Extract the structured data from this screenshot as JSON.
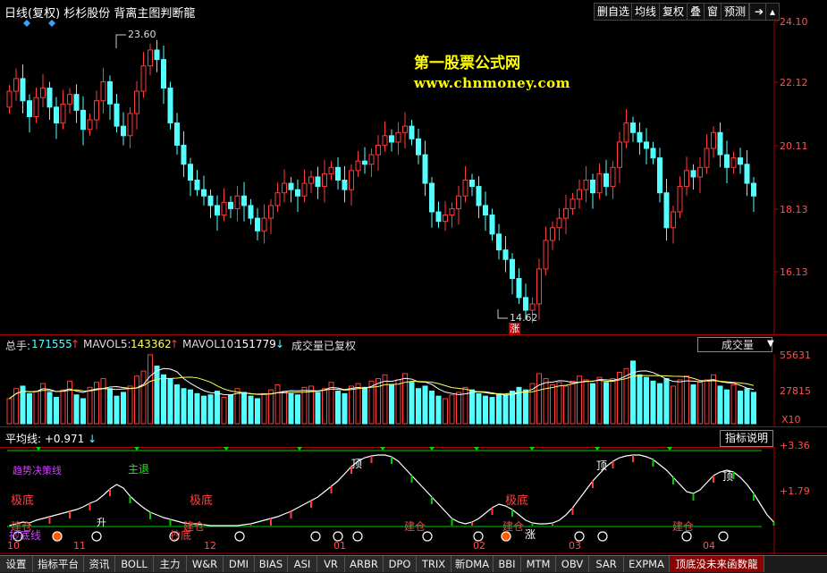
{
  "header": {
    "title": "日线(复权)  杉杉股份  背离主图判断龍",
    "buttons": [
      "删自选",
      "均线",
      "复权",
      "叠",
      "窗",
      "预测"
    ]
  },
  "watermark": {
    "line1": "第一股票公式网",
    "line2": "www.chnmoney.com"
  },
  "price_axis": [
    "24.10",
    "22.12",
    "20.11",
    "18.13",
    "16.13"
  ],
  "price_annotations": {
    "high": "23.60",
    "low": "14.62",
    "zhang": "涨"
  },
  "volume": {
    "total_label": "总手:",
    "total_value": "171555",
    "mavol5_label": "MAVOL5:",
    "mavol5_value": "143362",
    "mavol10_label": "MAVOL10:",
    "mavol10_value": "151779",
    "note": "成交量已复权",
    "select_value": "成交量",
    "axis": [
      "55631",
      "27815",
      "X10"
    ]
  },
  "indicator": {
    "legend_label": "平均线:",
    "legend_value": "+0.971",
    "help_button": "指标说明",
    "axis": [
      "+3.36",
      "+1.79"
    ],
    "labels": {
      "trend": "趋势决策线",
      "main_exit": "主退",
      "top1": "顶",
      "top2": "顶",
      "top3": "顶",
      "low1": "极底",
      "low2": "极底",
      "low3": "极底",
      "build1": "建仓",
      "build2": "建仓",
      "build3": "建仓",
      "build4": "建仓",
      "build5": "建仓",
      "buy": "抄底",
      "rise": "升",
      "up1": "涨",
      "baseline": "抄底线"
    }
  },
  "x_axis": [
    "10",
    "11",
    "12",
    "01",
    "02",
    "03",
    "04"
  ],
  "tabs": [
    "设置",
    "指标平台",
    "资讯",
    "BOLL",
    "主力",
    "W&R",
    "DMI",
    "BIAS",
    "ASI",
    "VR",
    "ARBR",
    "DPO",
    "TRIX",
    "新DMA",
    "BBI",
    "MTM",
    "OBV",
    "SAR",
    "EXPMA",
    "顶底没未来函数龍"
  ],
  "colors": {
    "up": "#ff3b3b",
    "down": "#54ffff",
    "ma": "#ffffff",
    "green": "#00dd00"
  }
}
